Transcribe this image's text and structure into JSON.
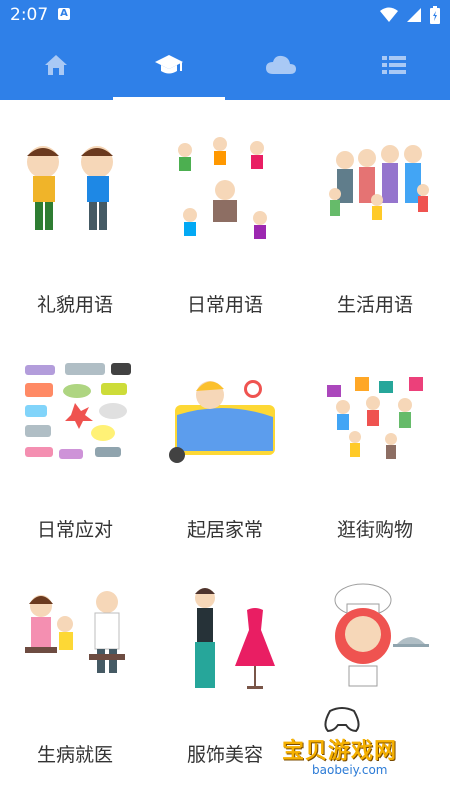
{
  "status_bar": {
    "time": "2:07",
    "notification_letter": "A"
  },
  "tabs": [
    {
      "name": "home-icon",
      "active": false
    },
    {
      "name": "graduation-cap-icon",
      "active": true
    },
    {
      "name": "cloud-icon",
      "active": false
    },
    {
      "name": "list-icon",
      "active": false
    }
  ],
  "categories": [
    {
      "label": "礼貌用语",
      "icon": "bowing-kids-illustration"
    },
    {
      "label": "日常用语",
      "icon": "daily-life-scenes-illustration"
    },
    {
      "label": "生活用语",
      "icon": "family-group-illustration"
    },
    {
      "label": "日常应对",
      "icon": "speech-bubbles-illustration"
    },
    {
      "label": "起居家常",
      "icon": "child-in-bed-illustration"
    },
    {
      "label": "逛街购物",
      "icon": "shopping-kids-illustration"
    },
    {
      "label": "生病就医",
      "icon": "doctor-visit-illustration"
    },
    {
      "label": "服饰美容",
      "icon": "fashion-dress-illustration"
    },
    {
      "label": "",
      "icon": "chef-illustration"
    }
  ],
  "watermark": {
    "text": "宝贝游戏网",
    "url": "baobeiy.com"
  },
  "colors": {
    "primary": "#2f80e8",
    "label_text": "#333333"
  }
}
